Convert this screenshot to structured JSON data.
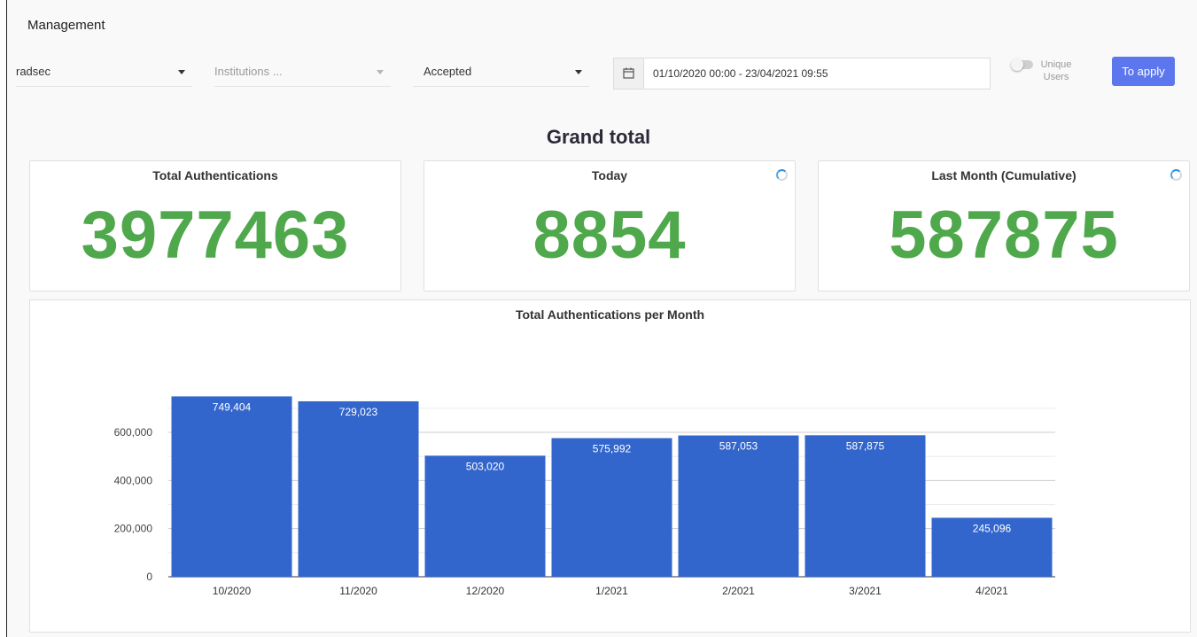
{
  "header": {
    "title": "Management"
  },
  "filters": {
    "realm": {
      "value": "radsec"
    },
    "institutions": {
      "placeholder": "Institutions ..."
    },
    "status": {
      "value": "Accepted"
    },
    "date_range": {
      "value": "01/10/2020 00:00 - 23/04/2021 09:55"
    },
    "unique_users": {
      "label": "Unique Users",
      "enabled": false
    },
    "apply_label": "To apply"
  },
  "summary": {
    "title": "Grand total",
    "cards": [
      {
        "label": "Total Authentications",
        "value": "3977463"
      },
      {
        "label": "Today",
        "value": "8854"
      },
      {
        "label": "Last Month (Cumulative)",
        "value": "587875"
      }
    ]
  },
  "colors": {
    "accent": "#5c77ee",
    "metric_green": "#4fa84b",
    "bar_blue": "#3366cc"
  },
  "chart_data": {
    "type": "bar",
    "title": "Total Authentications per Month",
    "categories": [
      "10/2020",
      "11/2020",
      "12/2020",
      "1/2021",
      "2/2021",
      "3/2021",
      "4/2021"
    ],
    "values": [
      749404,
      729023,
      503020,
      575992,
      587053,
      587875,
      245096
    ],
    "value_labels": [
      "749,404",
      "729,023",
      "503,020",
      "575,992",
      "587,053",
      "587,875",
      "245,096"
    ],
    "y_ticks": [
      0,
      200000,
      400000,
      600000
    ],
    "y_tick_labels": [
      "0",
      "200,000",
      "400,000",
      "600,000"
    ],
    "ylim": [
      0,
      750000
    ],
    "xlabel": "",
    "ylabel": "",
    "grid": true,
    "legend": "none"
  }
}
